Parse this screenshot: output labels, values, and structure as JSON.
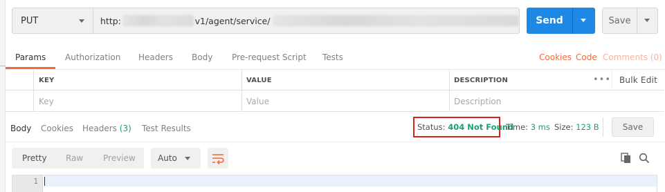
{
  "request": {
    "method": "PUT",
    "url_prefix": "http:",
    "url_middle": "v1/agent/service/",
    "send_label": "Send",
    "save_label": "Save"
  },
  "request_tabs": [
    "Params",
    "Authorization",
    "Headers",
    "Body",
    "Pre-request Script",
    "Tests"
  ],
  "request_links": {
    "cookies": "Cookies",
    "code": "Code",
    "comments": "Comments (0)"
  },
  "params_table": {
    "columns": [
      "KEY",
      "VALUE",
      "DESCRIPTION"
    ],
    "placeholders": {
      "key": "Key",
      "value": "Value",
      "description": "Description"
    },
    "more": "•••",
    "bulk_edit": "Bulk Edit"
  },
  "response": {
    "tabs": {
      "body": "Body",
      "cookies": "Cookies",
      "headers": "Headers",
      "headers_count": "(3)",
      "tests": "Test Results"
    },
    "status_label": "Status:",
    "status_value": "404 Not Found",
    "time_label": "Time:",
    "time_value": "3 ms",
    "size_label": "Size:",
    "size_value": "123 B",
    "save_label": "Save"
  },
  "viewer": {
    "modes": [
      "Pretty",
      "Raw",
      "Preview"
    ],
    "active_mode": "Pretty",
    "format": "Auto",
    "line_number": "1"
  },
  "colors": {
    "accent": "#f26b3a",
    "send": "#1e88e5",
    "success": "#1aa06b",
    "highlight_box": "#e0201a"
  },
  "icons": [
    "chevron-down-icon",
    "wrap-lines-icon",
    "copy-icon",
    "search-icon"
  ]
}
